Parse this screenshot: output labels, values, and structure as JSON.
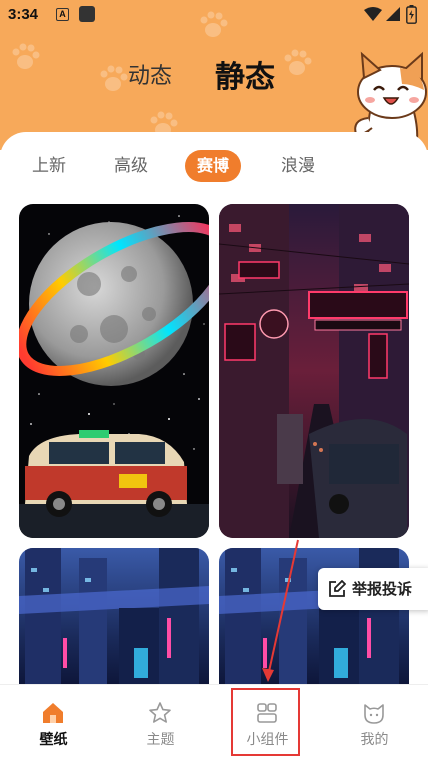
{
  "status_bar": {
    "time": "3:34",
    "notification_letter": "A",
    "icons": [
      "a-notification-icon",
      "app-square-icon",
      "wifi-icon",
      "signal-icon",
      "battery-icon"
    ]
  },
  "top_tabs": [
    {
      "label": "动态",
      "active": false
    },
    {
      "label": "静态",
      "active": true
    }
  ],
  "category_tabs": [
    {
      "label": "上新",
      "active": false
    },
    {
      "label": "高级",
      "active": false
    },
    {
      "label": "赛博",
      "active": true
    },
    {
      "label": "浪漫",
      "active": false
    }
  ],
  "wallpapers": [
    {
      "name": "moon-ring-taxi"
    },
    {
      "name": "neon-street-night"
    },
    {
      "name": "cyber-city-left"
    },
    {
      "name": "cyber-city-right"
    }
  ],
  "report_button": {
    "label": "举报投诉"
  },
  "bottom_nav": [
    {
      "label": "壁纸",
      "icon": "home-icon",
      "active": true
    },
    {
      "label": "主题",
      "icon": "star-icon",
      "active": false
    },
    {
      "label": "小组件",
      "icon": "widget-icon",
      "active": false
    },
    {
      "label": "我的",
      "icon": "cat-face-icon",
      "active": false
    }
  ],
  "colors": {
    "header_bg": "#f7a95a",
    "accent": "#f07d2c",
    "annotation": "#e53935"
  }
}
